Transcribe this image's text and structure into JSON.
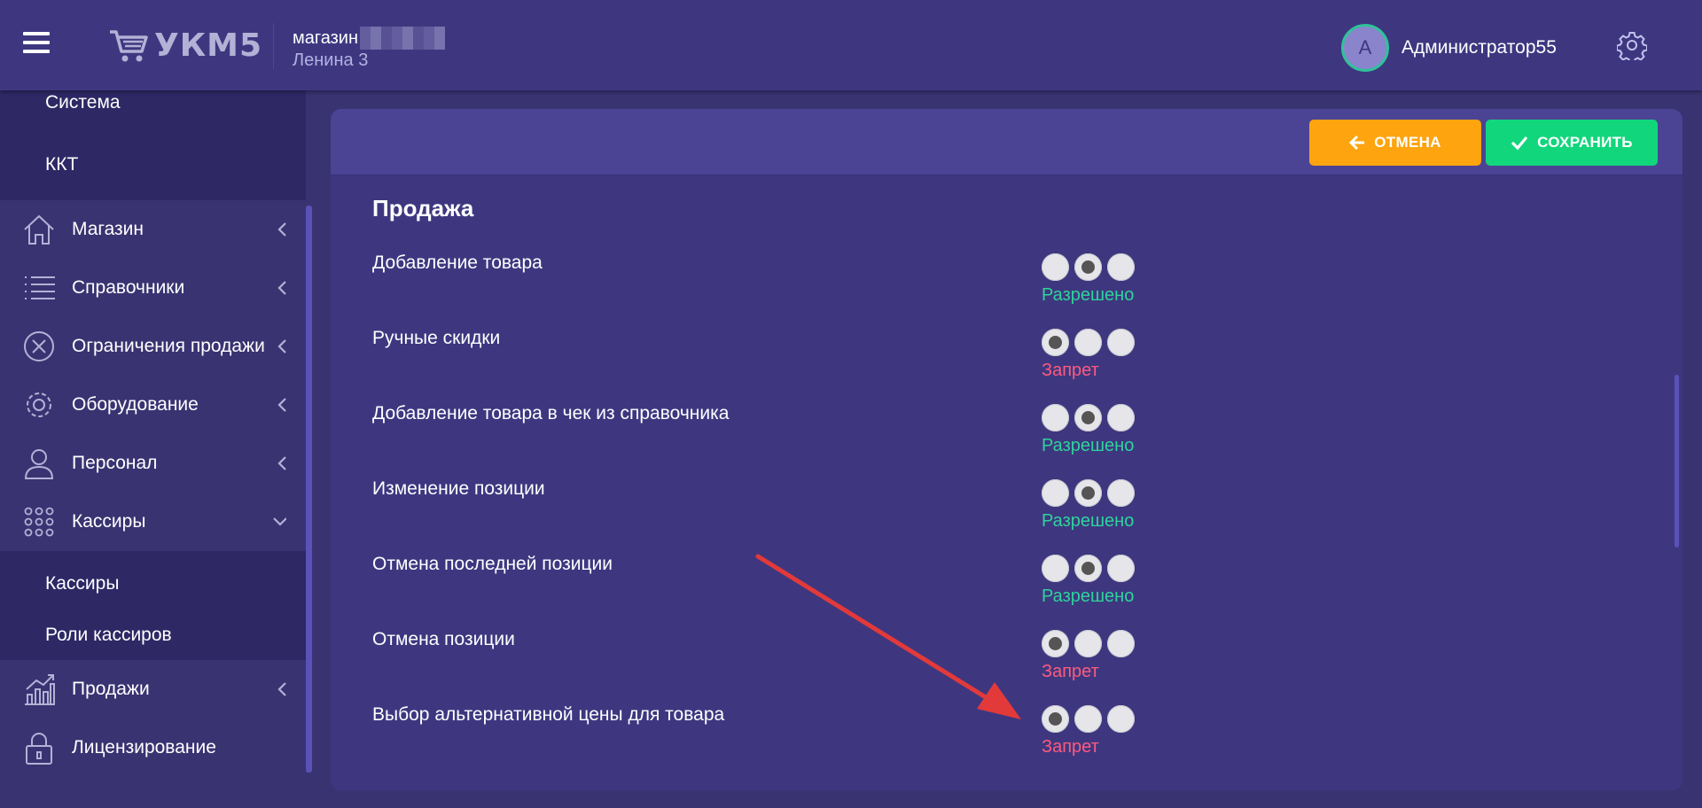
{
  "header": {
    "logo_text": "УКМ5",
    "store_name": "магазин",
    "store_address": "Ленина 3",
    "avatar_letter": "А",
    "username": "Администратор55"
  },
  "sidebar": {
    "top_subitems": [
      "Система",
      "ККТ"
    ],
    "items": [
      {
        "label": "Магазин",
        "icon": "home-icon",
        "state": "collapsed"
      },
      {
        "label": "Справочники",
        "icon": "list-icon",
        "state": "collapsed"
      },
      {
        "label": "Ограничения продажи",
        "icon": "cancel-circle-icon",
        "state": "collapsed"
      },
      {
        "label": "Оборудование",
        "icon": "gear-icon",
        "state": "collapsed"
      },
      {
        "label": "Персонал",
        "icon": "person-icon",
        "state": "collapsed"
      },
      {
        "label": "Кассиры",
        "icon": "grid-dots-icon",
        "state": "expanded"
      }
    ],
    "cashier_subitems": [
      "Кассиры",
      "Роли кассиров"
    ],
    "bottom_items": [
      {
        "label": "Продажи",
        "icon": "chart-icon",
        "state": "collapsed"
      },
      {
        "label": "Лицензирование",
        "icon": "lock-icon",
        "state": "none"
      }
    ]
  },
  "toolbar": {
    "cancel_label": "ОТМЕНА",
    "save_label": "СОХРАНИТЬ"
  },
  "section": {
    "title": "Продажа",
    "settings": [
      {
        "label": "Добавление товара",
        "selected": 2,
        "status": "Разрешено"
      },
      {
        "label": "Ручные скидки",
        "selected": 1,
        "status": "Запрет"
      },
      {
        "label": "Добавление товара в чек из справочника",
        "selected": 2,
        "status": "Разрешено"
      },
      {
        "label": "Изменение позиции",
        "selected": 2,
        "status": "Разрешено"
      },
      {
        "label": "Отмена последней позиции",
        "selected": 2,
        "status": "Разрешено"
      },
      {
        "label": "Отмена позиции",
        "selected": 1,
        "status": "Запрет"
      },
      {
        "label": "Выбор альтернативной цены для товара",
        "selected": 1,
        "status": "Запрет"
      }
    ]
  },
  "colors": {
    "background": "#3a3372",
    "header": "#3e3780",
    "cancel": "#fda40f",
    "save": "#12d67c",
    "allowed": "#2fd39a",
    "denied": "#ff5a7e",
    "annotation_arrow": "#e23a3a"
  }
}
